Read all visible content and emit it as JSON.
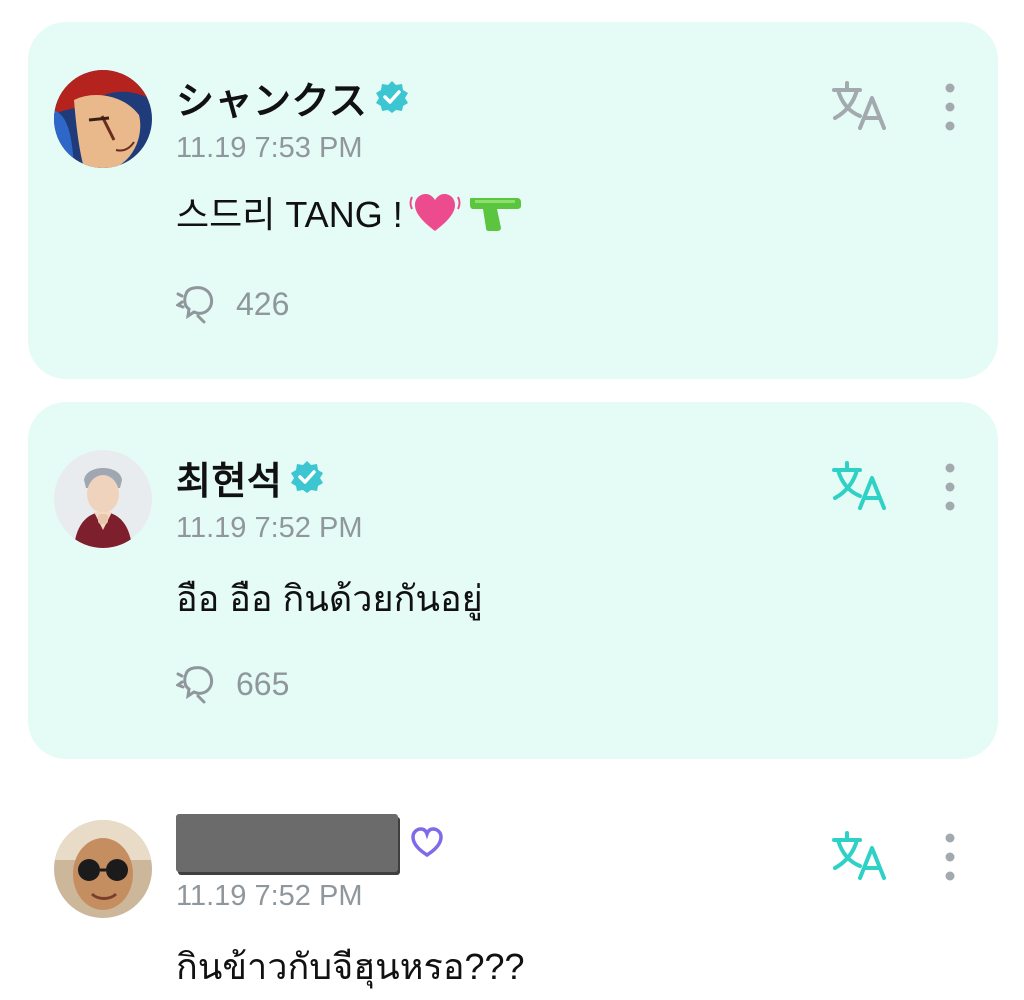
{
  "posts": [
    {
      "name": "シャンクス",
      "time": "11.19 7:53 PM",
      "text": "스드리 TANG !",
      "emoji": [
        "heart-pulse",
        "water-pistol"
      ],
      "reply_count": "426",
      "verified": true,
      "translate_color": "#a2aab0"
    },
    {
      "name": "최현석",
      "time": "11.19 7:52 PM",
      "text": "อือ อือ กินด้วยกันอยู่",
      "reply_count": "665",
      "verified": true,
      "translate_color": "#2ed1c5"
    },
    {
      "name": "",
      "time": "11.19 7:52 PM",
      "text": "กินข้าวกับจีฮุนหรอ???",
      "verified": false,
      "badge": "weverse-membership-icon",
      "translate_color": "#2ed1c5"
    }
  ],
  "colors": {
    "card_bg": "#e5fbf5",
    "verified": "#3bc6d1",
    "muted": "#8f979c",
    "accent": "#2ed1c5"
  }
}
